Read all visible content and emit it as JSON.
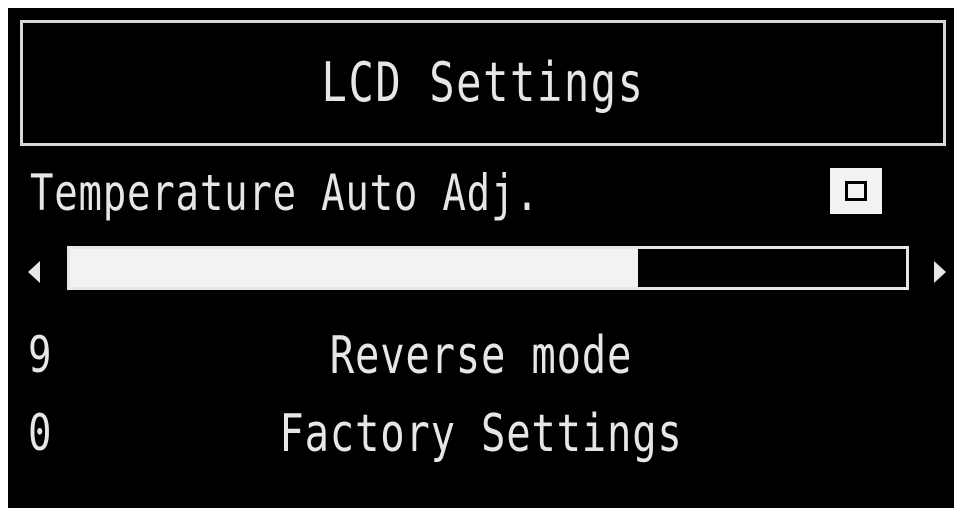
{
  "screen": {
    "title": "LCD Settings",
    "temperature_auto_adj": {
      "label": "Temperature Auto Adj.",
      "checkbox_icon": "checkbox-icon"
    },
    "slider": {
      "left_icon": "arrow-left-icon",
      "right_icon": "arrow-right-icon",
      "level": 0.68
    },
    "rows": [
      {
        "number": "9",
        "label": "Reverse mode"
      },
      {
        "number": "0",
        "label": "Factory Settings"
      }
    ]
  },
  "colors": {
    "background": "#000000",
    "foreground": "#e6e6e6",
    "fill": "#f2f2f2"
  }
}
